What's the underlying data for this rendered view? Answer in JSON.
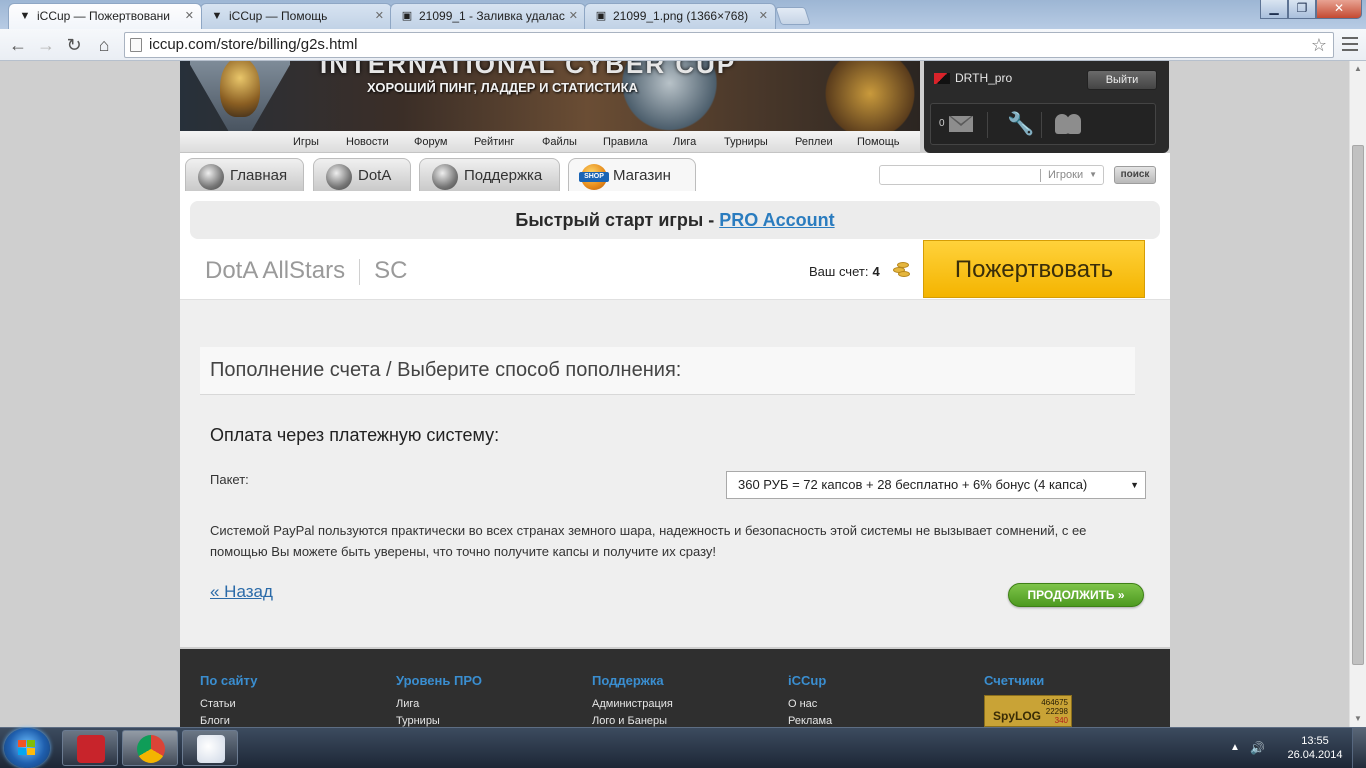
{
  "browser": {
    "tabs": [
      {
        "title": "iCCup — Пожертвовани"
      },
      {
        "title": "iCCup — Помощь"
      },
      {
        "title": "21099_1 - Заливка удалас"
      },
      {
        "title": "21099_1.png (1366×768)"
      }
    ],
    "url": "iccup.com/store/billing/g2s.html"
  },
  "header": {
    "brand": "INTERNATIONAL CYBER CUP",
    "slogan": "ХОРОШИЙ ПИНГ, ЛАДДЕР И СТАТИСТИКА",
    "menu": [
      "Игры",
      "Новости",
      "Форум",
      "Рейтинг",
      "Файлы",
      "Правила",
      "Лига",
      "Турниры",
      "Реплеи",
      "Помощь"
    ]
  },
  "user": {
    "name": "DRTH_pro",
    "logout_label": "Выйти",
    "messages_count": "0"
  },
  "site_tabs": [
    "Главная",
    "DotA",
    "Поддержка",
    "Магазин"
  ],
  "search": {
    "scope": "Игроки",
    "button_label": "поиск"
  },
  "promo": {
    "text": "Быстрый старт игры - ",
    "link": "PRO Account"
  },
  "store": {
    "games": [
      "DotA AllStars",
      "SC"
    ],
    "balance_label": "Ваш счет:",
    "balance_value": "4",
    "donate_label": "Пожертвовать"
  },
  "billing": {
    "heading": "Пополнение счета / Выберите способ пополнения:",
    "subheading": "Оплата через платежную систему:",
    "package_label": "Пакет:",
    "package_selected": "360 РУБ = 72 капсов + 28 бесплатно + 6% бонус (4 капса)",
    "description": "Системой PayPal пользуются практически во всех странах земного шара, надежность и безопасность этой системы не вызывает сомнений, с ее помощью Вы можете быть уверены, что точно получите капсы и получите их сразу!",
    "back_label": "« Назад",
    "continue_label": "ПРОДОЛЖИТЬ »"
  },
  "footer": {
    "columns": [
      {
        "title": "По сайту",
        "links": [
          "Статьи",
          "Блоги"
        ]
      },
      {
        "title": "Уровень ПРО",
        "links": [
          "Лига",
          "Турниры"
        ]
      },
      {
        "title": "Поддержка",
        "links": [
          "Администрация",
          "Лого и Банеры"
        ]
      },
      {
        "title": "iCCup",
        "links": [
          "О нас",
          "Реклама"
        ]
      },
      {
        "title": "Счетчики",
        "links": []
      }
    ],
    "counter": {
      "name": "SpyLOG",
      "values": [
        "464675",
        "22298",
        "340"
      ]
    }
  },
  "taskbar": {
    "time": "13:55",
    "date": "26.04.2014"
  }
}
